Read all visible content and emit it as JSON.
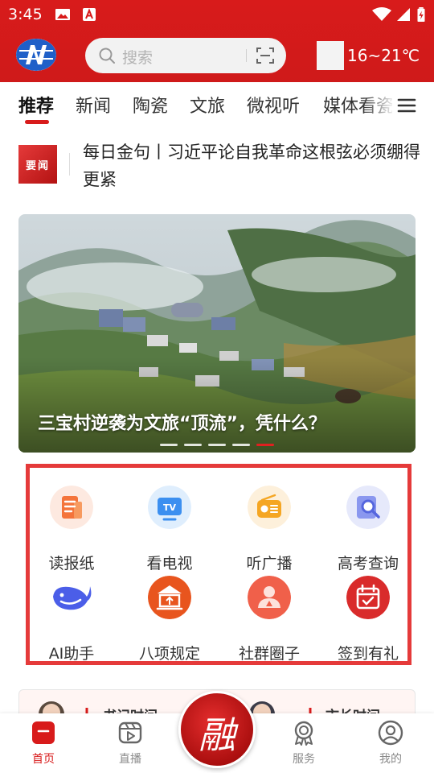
{
  "status_bar": {
    "time": "3:45"
  },
  "top_bar": {
    "search_placeholder": "搜索",
    "weather": "16~21℃"
  },
  "tabs": [
    {
      "label": "推荐",
      "active": true
    },
    {
      "label": "新闻"
    },
    {
      "label": "陶瓷"
    },
    {
      "label": "文旅"
    },
    {
      "label": "微视听"
    },
    {
      "label": "媒体看瓷"
    }
  ],
  "headline": {
    "badge": "要闻",
    "text": "每日金句丨习近平论自我革命这根弦必须绷得更紧"
  },
  "banner": {
    "title": "三宝村逆袭为文旅“顶流”，凭什么？",
    "slide_count": 5,
    "active_slide": 5
  },
  "quick_grid": [
    {
      "label": "读报纸",
      "icon": "newspaper-icon",
      "color": "#f4743b"
    },
    {
      "label": "看电视",
      "icon": "tv-icon",
      "color": "#3b8ff0"
    },
    {
      "label": "听广播",
      "icon": "radio-icon",
      "color": "#f5a623"
    },
    {
      "label": "高考查询",
      "icon": "search-doc-icon",
      "color": "#6b7be8"
    },
    {
      "label": "AI助手",
      "icon": "whale-icon",
      "color": "#4b5ee8"
    },
    {
      "label": "八项规定",
      "icon": "building-icon",
      "color": "#e8551e"
    },
    {
      "label": "社群圈子",
      "icon": "person-icon",
      "color": "#f0604a"
    },
    {
      "label": "签到有礼",
      "icon": "calendar-check-icon",
      "color": "#d92b2b"
    }
  ],
  "peek": {
    "left": "书记时间",
    "right": "市长时间"
  },
  "bottom_nav": [
    {
      "label": "首页",
      "active": true,
      "icon": "home-icon"
    },
    {
      "label": "直播",
      "icon": "live-icon"
    },
    {
      "label": "融",
      "icon": "rong-icon"
    },
    {
      "label": "服务",
      "icon": "service-icon"
    },
    {
      "label": "我的",
      "icon": "profile-icon"
    }
  ],
  "colors": {
    "brand": "#d81b1b",
    "highlight_frame": "#e53a3a"
  }
}
